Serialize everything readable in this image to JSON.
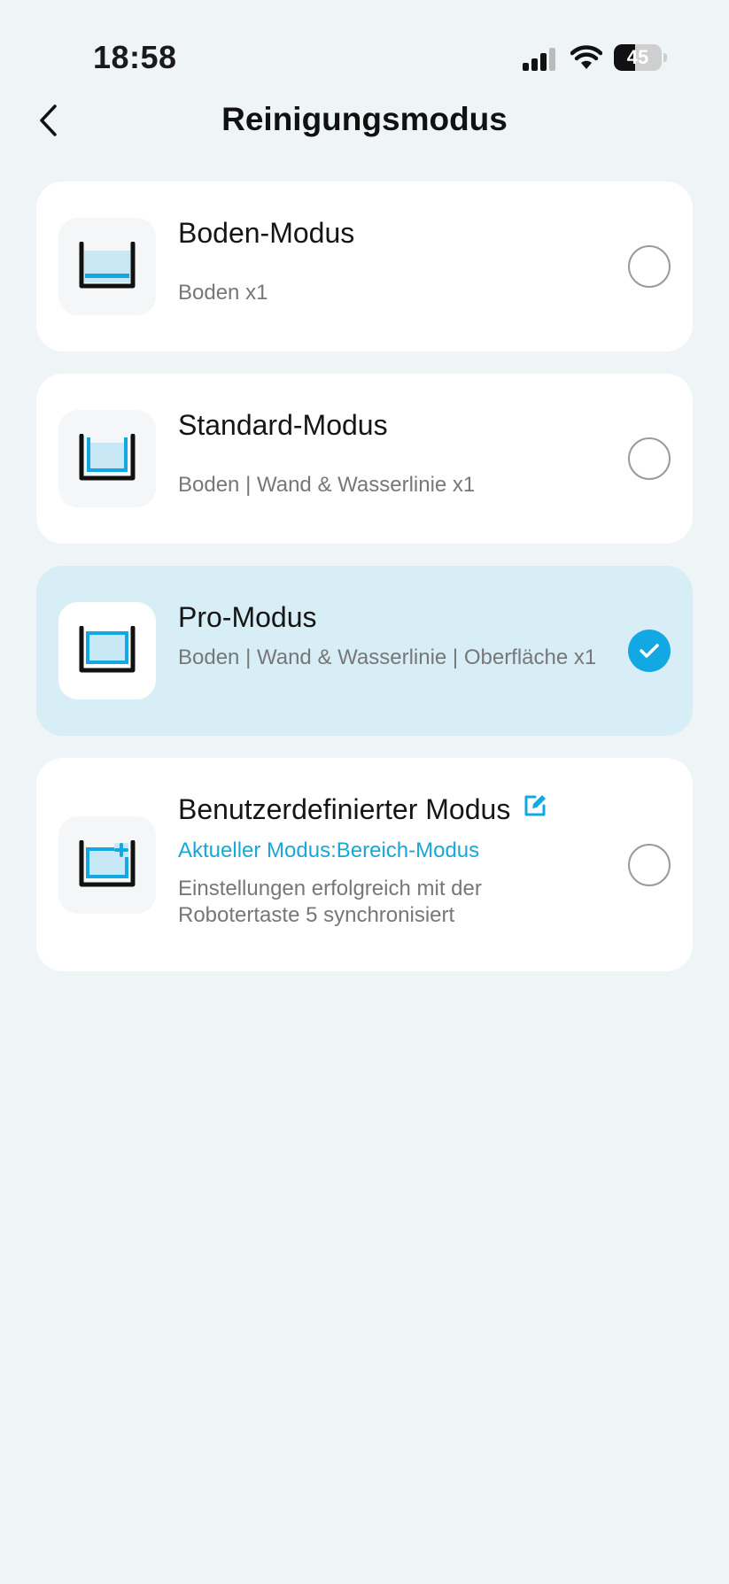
{
  "status_bar": {
    "time": "18:58",
    "battery_level": 45,
    "battery_text": "45"
  },
  "header": {
    "title": "Reinigungsmodus",
    "back_icon": "chevron-left-icon"
  },
  "modes": [
    {
      "title": "Boden-Modus",
      "subtitle": "Boden x1",
      "selected": false,
      "icon": "floor-mode-icon"
    },
    {
      "title": "Standard-Modus",
      "subtitle": "Boden | Wand & Wasserlinie x1",
      "selected": false,
      "icon": "standard-mode-icon"
    },
    {
      "title": "Pro-Modus",
      "subtitle": "Boden | Wand & Wasserlinie | Oberfläche x1",
      "selected": true,
      "icon": "pro-mode-icon"
    },
    {
      "title": "Benutzerdefinierter Modus",
      "current_mode": "Aktueller Modus:Bereich-Modus",
      "subtitle": "Einstellungen erfolgreich mit der Robotertaste 5 synchronisiert",
      "selected": false,
      "icon": "custom-mode-icon",
      "edit_icon": "edit-icon"
    }
  ],
  "colors": {
    "accent": "#12a8e3",
    "selected_card": "#d8eef7",
    "background": "#eff4f7",
    "link": "#1aa6d8"
  }
}
